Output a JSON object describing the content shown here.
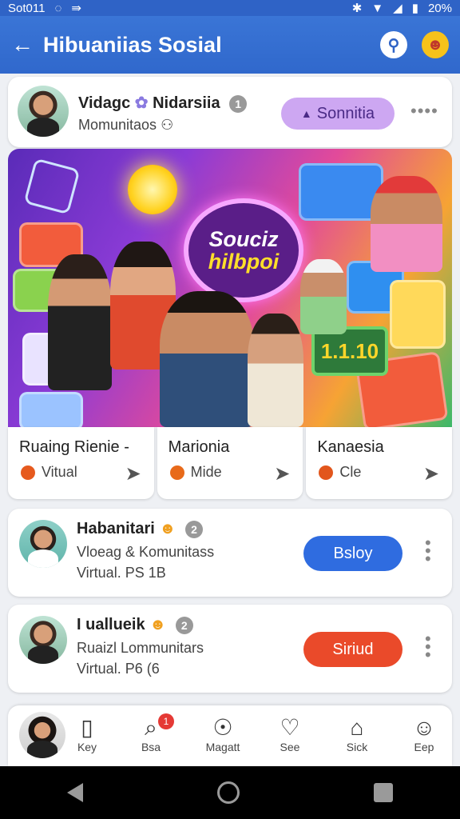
{
  "status": {
    "carrier": "Sot011",
    "battery": "20%"
  },
  "appbar": {
    "title": "Hibuaniias Sosial"
  },
  "post": {
    "name": "Vidagc",
    "name2": "Nidarsiia",
    "badge": "1",
    "subtitle": "Momunitaos",
    "follow_label": "Sonnitia",
    "more": "••••"
  },
  "banner": {
    "line1": "Souciz",
    "line2": "hilbpoi",
    "screen_text": "1.1.10"
  },
  "categories": [
    {
      "title": "Ruaing Rienie  -",
      "sub": "Vitual",
      "color": "#e65a1e"
    },
    {
      "title": "Marionia",
      "sub": "Mide",
      "color": "#e86a1a"
    },
    {
      "title": "Kanaesia",
      "sub": "Cle",
      "color": "#e2561c"
    }
  ],
  "communities": [
    {
      "name": "Habanitari",
      "badge": "2",
      "desc": "Vloeag & Komunitass",
      "meta": "Virtual. PS 1B",
      "button": "Bsloy",
      "button_color": "#2f6ce0"
    },
    {
      "name": "I uallueik",
      "badge": "2",
      "desc": "Ruaizl Lommunitars",
      "meta": "Virtual. P6 (6",
      "button": "Siriud",
      "button_color": "#ea4a2a"
    }
  ],
  "bottomnav": [
    {
      "label": "Key",
      "icon": "bookmark-icon",
      "glyph": "▯"
    },
    {
      "label": "Bsa",
      "icon": "search-icon",
      "glyph": "⌕",
      "dot": "1"
    },
    {
      "label": "Magatt",
      "icon": "compass-icon",
      "glyph": "☉"
    },
    {
      "label": "See",
      "icon": "heart-icon",
      "glyph": "♡"
    },
    {
      "label": "Sick",
      "icon": "store-icon",
      "glyph": "⌂"
    },
    {
      "label": "Eep",
      "icon": "profile-icon",
      "glyph": "☺"
    }
  ]
}
